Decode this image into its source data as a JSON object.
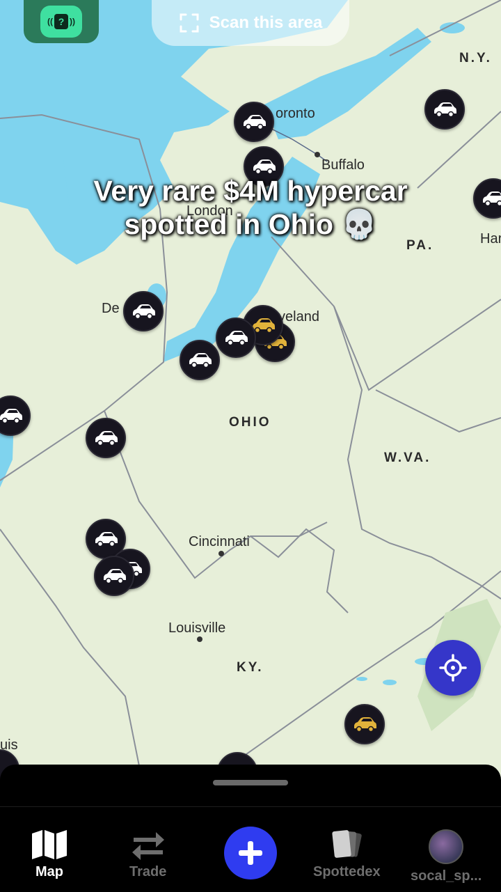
{
  "top": {
    "badge_glyph": "?",
    "scan_label": "Scan this area"
  },
  "caption": {
    "line1": "Very rare $4M hypercar",
    "line2": "spotted in Ohio 💀"
  },
  "map": {
    "cities": {
      "toronto": "oronto",
      "buffalo": "Buffalo",
      "london": "London",
      "detroit": "De",
      "cleveland": "veland",
      "cincinnati": "Cincinnati",
      "louisville": "Louisville",
      "har": "Har",
      "uis": "uis"
    },
    "states": {
      "ny": "N.Y.",
      "pa": "PA.",
      "ohio": "OHIO",
      "wva": "W.VA.",
      "ky": "KY."
    },
    "colors": {
      "water": "#7fd3ee",
      "land": "#e7efd9",
      "border": "#8a8f99",
      "marker_bg": "#17151f",
      "car_white": "#ffffff",
      "car_gold": "#e2b33b"
    }
  },
  "tabs": [
    {
      "label": "Map",
      "icon": "map-icon",
      "active": true
    },
    {
      "label": "Trade",
      "icon": "trade-icon",
      "active": false
    },
    {
      "label": "",
      "icon": "plus-icon",
      "active": false
    },
    {
      "label": "Spottedex",
      "icon": "cards-icon",
      "active": false
    },
    {
      "label": "socal_sp...",
      "icon": "avatar-icon",
      "active": false
    }
  ],
  "accent_color": "#2f3cf0"
}
